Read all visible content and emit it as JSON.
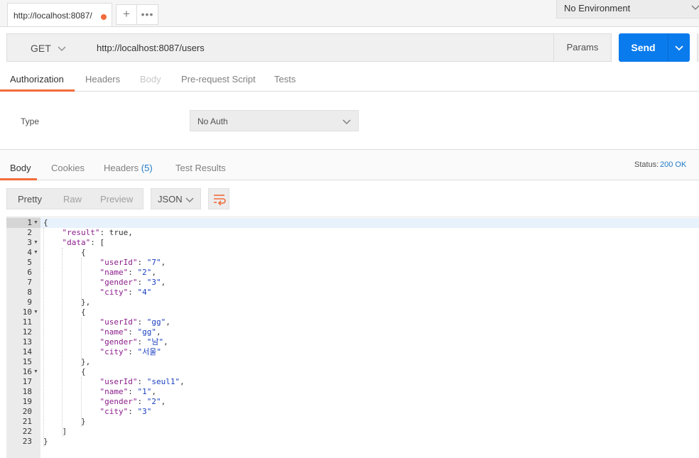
{
  "tabs": {
    "request_tab": "http://localhost:8087/",
    "add": "+",
    "more": "•••"
  },
  "environment": {
    "selected": "No Environment"
  },
  "request": {
    "method": "GET",
    "url": "http://localhost:8087/users",
    "params_label": "Params",
    "send_label": "Send"
  },
  "request_tabs": [
    {
      "label": "Authorization",
      "state": "active"
    },
    {
      "label": "Headers",
      "state": "normal"
    },
    {
      "label": "Body",
      "state": "disabled"
    },
    {
      "label": "Pre-request Script",
      "state": "normal"
    },
    {
      "label": "Tests",
      "state": "normal"
    }
  ],
  "auth": {
    "type_label": "Type",
    "type_value": "No Auth"
  },
  "response_tabs": [
    {
      "label": "Body"
    },
    {
      "label": "Cookies"
    },
    {
      "label": "Headers",
      "count": "(5)"
    },
    {
      "label": "Test Results"
    }
  ],
  "status": {
    "label": "Status:",
    "value": "200 OK"
  },
  "format": {
    "modes": [
      "Pretty",
      "Raw",
      "Preview"
    ],
    "active": "Pretty",
    "language": "JSON"
  },
  "colors": {
    "accent": "#f26b3a",
    "primary": "#097bed",
    "json_key": "#8a1c8a",
    "json_string": "#1a3fbf"
  },
  "icons": {
    "wrap": "wrap-lines-icon",
    "chevron": "chevron-down-icon",
    "fold": "fold-arrow-icon"
  },
  "code_lines": [
    "{",
    "    \"result\": true,",
    "    \"data\": [",
    "        {",
    "            \"userId\": \"7\",",
    "            \"name\": \"2\",",
    "            \"gender\": \"3\",",
    "            \"city\": \"4\"",
    "        },",
    "        {",
    "            \"userId\": \"gg\",",
    "            \"name\": \"gg\",",
    "            \"gender\": \"남\",",
    "            \"city\": \"서울\"",
    "        },",
    "        {",
    "            \"userId\": \"seul1\",",
    "            \"name\": \"1\",",
    "            \"gender\": \"2\",",
    "            \"city\": \"3\"",
    "        }",
    "    ]",
    "}"
  ],
  "foldable_lines": [
    1,
    3,
    4,
    10,
    16
  ]
}
